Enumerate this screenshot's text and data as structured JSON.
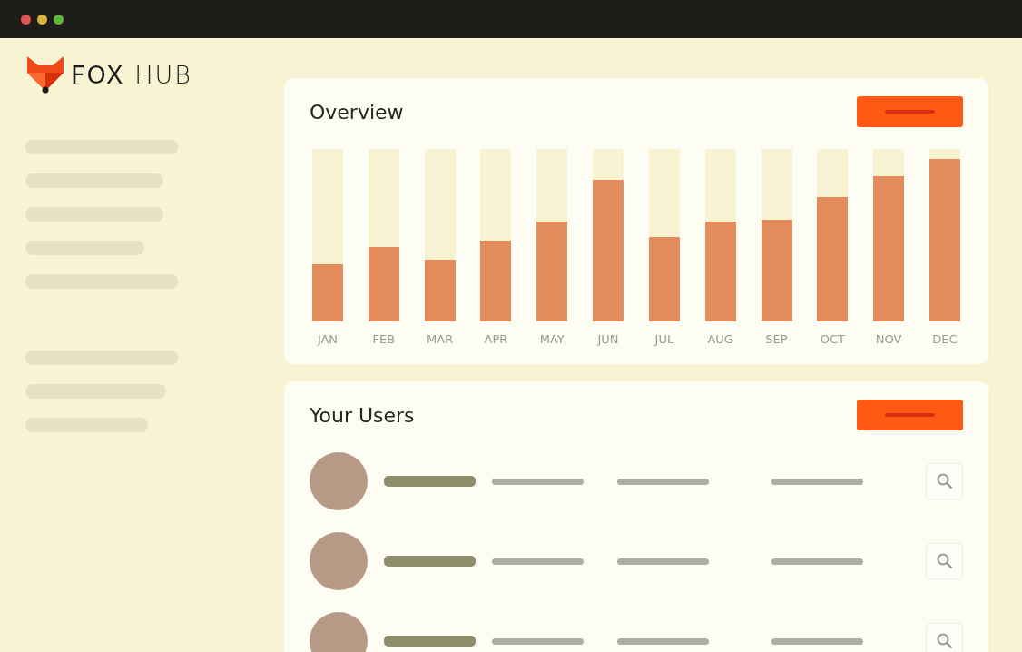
{
  "logo": {
    "text": "**FOX** HUB"
  },
  "overview": {
    "title": "Overview",
    "months": [
      {
        "label": "JAN",
        "level": 0.33
      },
      {
        "label": "FEB",
        "level": 0.43
      },
      {
        "label": "MAR",
        "level": 0.36
      },
      {
        "label": "APR",
        "level": 0.47
      },
      {
        "label": "MAY",
        "level": 0.58
      },
      {
        "label": "JUN",
        "level": 0.82
      },
      {
        "label": "JUL",
        "level": 0.49
      },
      {
        "label": "AUG",
        "level": 0.58
      },
      {
        "label": "SEP",
        "level": 0.59
      },
      {
        "label": "OCT",
        "level": 0.72
      },
      {
        "label": "NOV",
        "level": 0.84
      },
      {
        "label": "DEC",
        "level": 0.94
      }
    ]
  },
  "users": {
    "title": "Your Users",
    "rows": [
      {
        "kind": "placeholder"
      },
      {
        "kind": "placeholder"
      },
      {
        "kind": "placeholder"
      }
    ]
  }
}
